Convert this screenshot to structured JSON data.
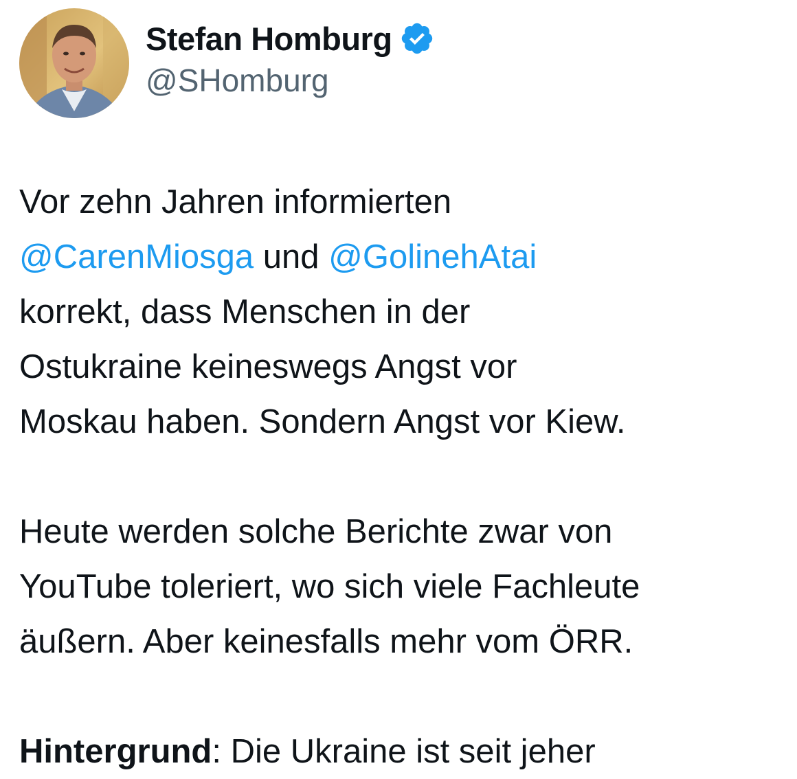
{
  "author": {
    "display_name": "Stefan Homburg",
    "handle": "@SHomburg",
    "verified": true,
    "avatar_icon": "profile-photo"
  },
  "tweet": {
    "p1": {
      "l1": "Vor zehn Jahren informierten",
      "mention1": "@CarenMiosga",
      "und": " und ",
      "mention2": "@GolinehAtai",
      "l3": "korrekt, dass Menschen in der",
      "l4": "Ostukraine keineswegs Angst vor",
      "l5": "Moskau haben. Sondern Angst vor Kiew."
    },
    "p2": {
      "l1": "Heute werden solche Berichte zwar von",
      "l2": "YouTube toleriert, wo sich viele Fachleute",
      "l3": "äußern. Aber keinesfalls mehr vom ÖRR."
    },
    "p3": {
      "bold": "Hintergrund",
      "rest": ": Die Ukraine ist seit jeher"
    }
  },
  "colors": {
    "mention": "#1d9bf0",
    "verified_badge": "#1d9bf0",
    "handle": "#536471",
    "text": "#0f1419"
  }
}
